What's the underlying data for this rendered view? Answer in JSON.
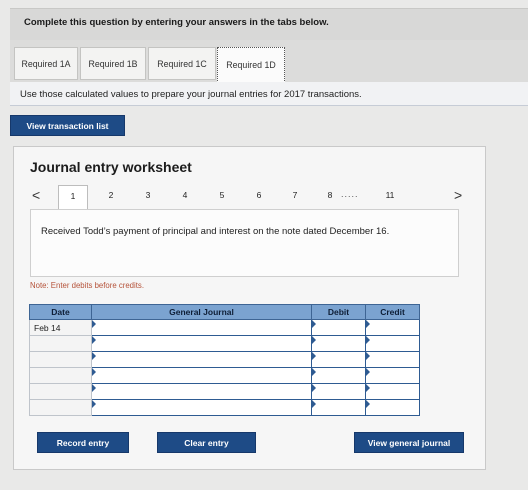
{
  "instruction": "Complete this question by entering your answers in the tabs below.",
  "tabs": [
    {
      "label": "Required 1A",
      "active": false
    },
    {
      "label": "Required 1B",
      "active": false
    },
    {
      "label": "Required 1C",
      "active": false
    },
    {
      "label": "Required 1D",
      "active": true
    }
  ],
  "tab_description": "Use those calculated values to prepare your journal entries for 2017 transactions.",
  "view_transaction_label": "View transaction list",
  "worksheet": {
    "title": "Journal entry worksheet",
    "prev_arrow": "<",
    "next_arrow": ">",
    "pages": [
      "1",
      "2",
      "3",
      "4",
      "5",
      "6",
      "7",
      "8",
      "11"
    ],
    "ellipsis": ".....",
    "current_page": "1",
    "description": "Received Todd’s payment of principal and interest on the note dated December 16.",
    "note": "Note: Enter debits before credits.",
    "table": {
      "headers": [
        "Date",
        "General Journal",
        "Debit",
        "Credit"
      ],
      "rows": [
        {
          "date": "Feb 14",
          "account": "",
          "debit": "",
          "credit": ""
        },
        {
          "date": "",
          "account": "",
          "debit": "",
          "credit": ""
        },
        {
          "date": "",
          "account": "",
          "debit": "",
          "credit": ""
        },
        {
          "date": "",
          "account": "",
          "debit": "",
          "credit": ""
        },
        {
          "date": "",
          "account": "",
          "debit": "",
          "credit": ""
        },
        {
          "date": "",
          "account": "",
          "debit": "",
          "credit": ""
        }
      ]
    },
    "buttons": {
      "record": "Record entry",
      "clear": "Clear entry",
      "view_journal": "View general journal"
    }
  },
  "colors": {
    "button": "#1e4b86",
    "table_header": "#7ba3d0",
    "note": "#b5533a"
  }
}
